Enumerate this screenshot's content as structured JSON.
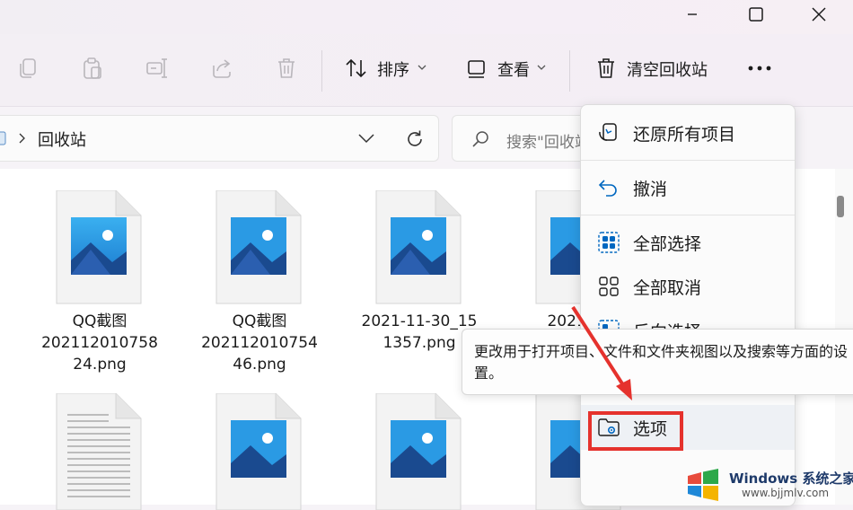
{
  "window": {
    "controls": {
      "minimize": "minimize",
      "maximize": "maximize",
      "close": "close"
    }
  },
  "command_bar": {
    "sort_label": "排序",
    "view_label": "查看",
    "empty_recycle_bin_label": "清空回收站",
    "icons": [
      "copy-icon",
      "paste-icon",
      "rename-icon",
      "share-icon",
      "delete-icon",
      "sort-icon",
      "view-icon",
      "recycle-bin-icon",
      "more-icon"
    ]
  },
  "address_bar": {
    "location": "回收站",
    "search_placeholder": "搜索\"回收站"
  },
  "files": [
    {
      "line1": "QQ截图",
      "line2": "202112010758",
      "line3": "24.png",
      "type": "image"
    },
    {
      "line1": "QQ截图",
      "line2": "202112010754",
      "line3": "46.png",
      "type": "image"
    },
    {
      "line1": "2021-11-30_15",
      "line2": "1357.png",
      "line3": "",
      "type": "image"
    },
    {
      "line1": "2021-11",
      "line2": "",
      "line3": "",
      "type": "image"
    },
    {
      "type": "document"
    },
    {
      "type": "image"
    },
    {
      "type": "image"
    },
    {
      "type": "image"
    }
  ],
  "context_menu": {
    "items": [
      {
        "label": "还原所有项目",
        "icon": "restore-icon"
      },
      {
        "label": "撤消",
        "icon": "undo-icon"
      },
      {
        "label": "全部选择",
        "icon": "select-all-icon"
      },
      {
        "label": "全部取消",
        "icon": "select-none-icon"
      },
      {
        "label": "反向选择",
        "icon": "invert-selection-icon"
      },
      {
        "label": "选项",
        "icon": "options-icon"
      }
    ]
  },
  "tooltip": {
    "text": "更改用于打开项目、文件和文件夹视图以及搜索等方面的设置。"
  },
  "watermark": {
    "brand": "Windows 系统之家",
    "url": "www.bjjmlv.com"
  },
  "colors": {
    "highlight": "#e5322d",
    "accent": "#0067c0"
  }
}
